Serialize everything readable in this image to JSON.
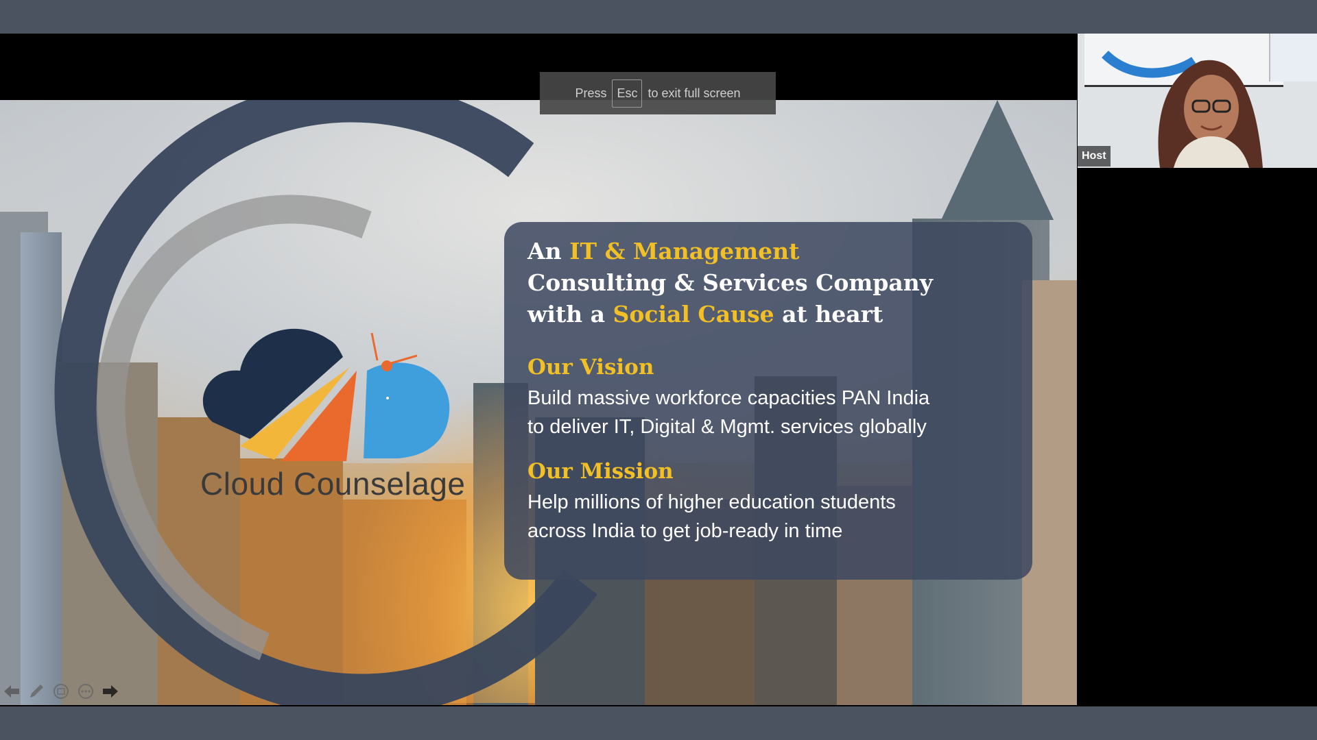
{
  "esc_toast": {
    "press": "Press",
    "key": "Esc",
    "suffix": "to exit full screen"
  },
  "slide": {
    "brand": "Cloud Counselage",
    "headline": {
      "p1": "An ",
      "h1": "IT & Management",
      "p2": "Consulting & Services Company",
      "p3": "with a ",
      "h2": "Social Cause",
      "p4": " at heart"
    },
    "vision": {
      "title": "Our Vision",
      "line1": "Build massive workforce capacities PAN India",
      "line2": "to deliver IT, Digital & Mgmt. services globally"
    },
    "mission": {
      "title": "Our Mission",
      "line1": "Help millions of higher education students",
      "line2": "across India to get job-ready in time"
    }
  },
  "participant": {
    "label": "Host"
  },
  "colors": {
    "accent": "#f2c024",
    "panel": "#3e4860",
    "logo_navy": "#1e2f4a",
    "logo_yellow": "#f2b63a",
    "logo_orange": "#ea6a2d",
    "logo_blue": "#3e9fdc"
  },
  "toolbar_icons": [
    "arrow-left-icon",
    "pen-icon",
    "slides-icon",
    "more-icon",
    "arrow-right-icon"
  ]
}
